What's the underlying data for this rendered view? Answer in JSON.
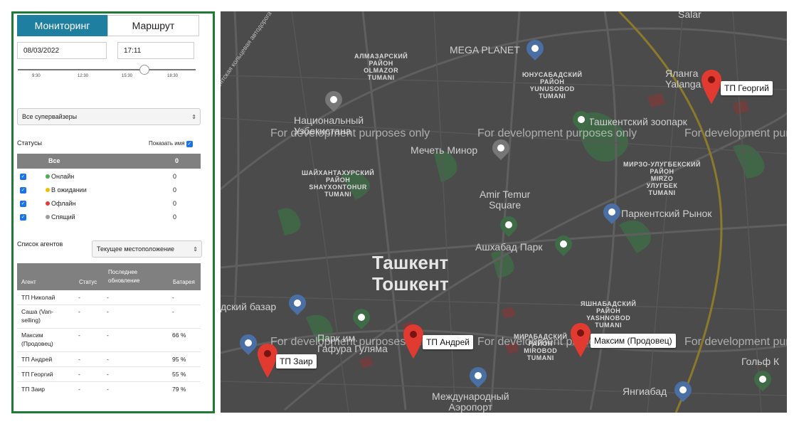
{
  "tabs": {
    "monitoring": "Мониторинг",
    "route": "Маршрут"
  },
  "date": "08/03/2022",
  "time": "17:11",
  "slider": {
    "ticks": [
      "9:30",
      "12:30",
      "15:30",
      "18:30"
    ],
    "position_fraction": 0.72
  },
  "supervisor_select": "Все супервайзеры",
  "statuses": {
    "label": "Статусы",
    "show_name_label": "Показать имя",
    "header_all": "Все",
    "header_count": "0",
    "rows": [
      {
        "label": "Онлайн",
        "count": "0",
        "color": "#4caf50"
      },
      {
        "label": "В ожидании",
        "count": "0",
        "color": "#f0c000"
      },
      {
        "label": "Офлайн",
        "count": "0",
        "color": "#e53935"
      },
      {
        "label": "Спящий",
        "count": "0",
        "color": "#9e9e9e"
      }
    ]
  },
  "agents": {
    "label": "Список агентов",
    "select": "Текущее местоположение",
    "columns": {
      "agent": "Агент",
      "status": "Статус",
      "updated_1": "Последнее",
      "updated_2": "обновление",
      "battery": "Батарея"
    },
    "rows": [
      {
        "name1": "ТП Николай",
        "name2": "",
        "status": "-",
        "updated": "-",
        "battery": "-"
      },
      {
        "name1": "Саша (Van-",
        "name2": "selling)",
        "status": "-",
        "updated": "-",
        "battery": "-"
      },
      {
        "name1": "Максим",
        "name2": "(Продовец)",
        "status": "-",
        "updated": "-",
        "battery": "66 %"
      },
      {
        "name1": "ТП Андрей",
        "name2": "",
        "status": "-",
        "updated": "-",
        "battery": "95 %"
      },
      {
        "name1": "ТП Георгий",
        "name2": "",
        "status": "-",
        "updated": "-",
        "battery": "55 %"
      },
      {
        "name1": "ТП Заир",
        "name2": "",
        "status": "-",
        "updated": "-",
        "battery": "79 %"
      }
    ]
  },
  "map": {
    "city_1": "Ташкент",
    "city_2": "Тошкент",
    "watermark": "For development purposes only",
    "places": {
      "mega_planet": "MEGA PLANET",
      "salar": "Salar",
      "national_univ_1": "Национальный",
      "national_univ_2": "Узбекистана",
      "minor_mosque": "Мечеть Минор",
      "zoo": "Ташкентский зоопарк",
      "yalangach_1": "Яланга",
      "yalangach_2": "Yalanga",
      "amir_temur_1": "Amir Temur",
      "amir_temur_2": "Square",
      "parkent_market": "Паркентский Рынок",
      "ashkhabad_park": "Ашхабад Парк",
      "bazaar": "дский базар",
      "gafur_1": "Парк им.",
      "gafur_2": "Гафура Гуляма",
      "golf": "Гольф К",
      "yangiabad": "Янгиабад",
      "airport_1": "Международный",
      "airport_2": "Аэропорт",
      "ring_road": "Ташкентская кольцевая автодорога"
    },
    "districts": {
      "almazar": [
        "АЛМАЗАРСКИЙ",
        "РАЙОН",
        "OLMAZOR",
        "TUMANI"
      ],
      "yunusabad": [
        "ЮНУСАБАДСКИЙ",
        "РАЙОН",
        "YUNUSOBOD",
        "TUMANI"
      ],
      "shaykhantakhur": [
        "ШАЙХАНТАХУРСКИЙ",
        "РАЙОН",
        "SHAYXONTOHUR",
        "TUMANI"
      ],
      "mirzo": [
        "МИРЗО-УЛУГБЕКСКИЙ",
        "РАЙОН",
        "MIRZO",
        "УЛУГБЕК",
        "TUMANI"
      ],
      "yashnabad": [
        "ЯШНАБАДСКИЙ",
        "РАЙОН",
        "YASHNOBOD",
        "TUMANI"
      ],
      "mirabad": [
        "МИРАБАДСКИЙ",
        "РАЙОН",
        "MIROBOD",
        "TUMANI"
      ]
    },
    "pins": [
      {
        "label": "ТП Георгий"
      },
      {
        "label": "ТП Андрей"
      },
      {
        "label": "Максим (Продовец)"
      },
      {
        "label": "ТП Заир"
      }
    ]
  }
}
